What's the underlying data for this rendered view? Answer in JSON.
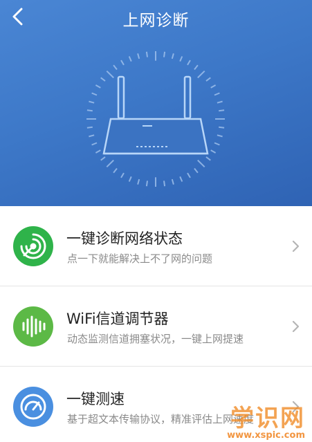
{
  "header": {
    "title": "上网诊断",
    "back_icon": "back-arrow-icon"
  },
  "colors": {
    "header_blue": "#3d78c8",
    "diagnose_green": "#2fb34a",
    "wifi_green": "#5cb946",
    "speed_blue": "#4a8fe0",
    "watermark_orange": "#f08c28"
  },
  "menu": {
    "items": [
      {
        "title": "一键诊断网络状态",
        "desc": "点一下就能解决上不了网的问题",
        "icon": "diagnose-icon"
      },
      {
        "title": "WiFi信道调节器",
        "desc": "动态监测信道拥塞状况，一键上网提速",
        "icon": "signal-wave-icon"
      },
      {
        "title": "一键测速",
        "desc": "基于超文本传输协议，精准评估上网速度",
        "icon": "speedometer-icon"
      }
    ]
  },
  "watermark": {
    "logo": "学识网",
    "url": "www.xspic.com"
  }
}
